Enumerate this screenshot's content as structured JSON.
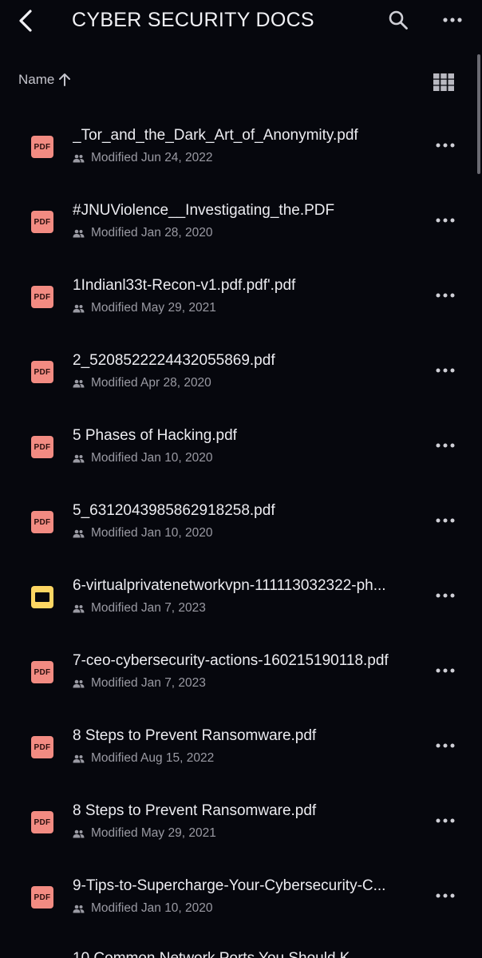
{
  "header": {
    "title": "CYBER SECURITY DOCS",
    "back_icon": "chevron-left-icon",
    "search_icon": "search-icon",
    "more_icon": "more-horizontal-icon"
  },
  "sort": {
    "label": "Name",
    "direction_icon": "arrow-up-icon",
    "view_toggle_icon": "grid-view-icon"
  },
  "colors": {
    "background": "#06070d",
    "pdf_icon": "#f28b82",
    "slides_icon": "#fdd663",
    "text_primary": "#ececf1",
    "text_secondary": "#9a9aa3"
  },
  "files": [
    {
      "name": "_Tor_and_the_Dark_Art_of_Anonymity.pdf",
      "modified": "Modified Jun 24, 2022",
      "type": "pdf",
      "icon_label": "PDF"
    },
    {
      "name": "#JNUViolence__Investigating_the.PDF",
      "modified": "Modified Jan 28, 2020",
      "type": "pdf",
      "icon_label": "PDF"
    },
    {
      "name": "1Indianl33t-Recon-v1.pdf.pdf'.pdf",
      "modified": "Modified May 29, 2021",
      "type": "pdf",
      "icon_label": "PDF"
    },
    {
      "name": "2_5208522224432055869.pdf",
      "modified": "Modified Apr 28, 2020",
      "type": "pdf",
      "icon_label": "PDF"
    },
    {
      "name": "5 Phases of Hacking.pdf",
      "modified": "Modified Jan 10, 2020",
      "type": "pdf",
      "icon_label": "PDF"
    },
    {
      "name": "5_6312043985862918258.pdf",
      "modified": "Modified Jan 10, 2020",
      "type": "pdf",
      "icon_label": "PDF"
    },
    {
      "name": "6-virtualprivatenetworkvpn-111113032322-ph...",
      "modified": "Modified Jan 7, 2023",
      "type": "slides",
      "icon_label": ""
    },
    {
      "name": "7-ceo-cybersecurity-actions-160215190118.pdf",
      "modified": "Modified Jan 7, 2023",
      "type": "pdf",
      "icon_label": "PDF"
    },
    {
      "name": "8 Steps to Prevent Ransomware.pdf",
      "modified": "Modified Aug 15, 2022",
      "type": "pdf",
      "icon_label": "PDF"
    },
    {
      "name": "8 Steps to Prevent Ransomware.pdf",
      "modified": "Modified May 29, 2021",
      "type": "pdf",
      "icon_label": "PDF"
    },
    {
      "name": "9-Tips-to-Supercharge-Your-Cybersecurity-C...",
      "modified": "Modified Jan 10, 2020",
      "type": "pdf",
      "icon_label": "PDF"
    }
  ],
  "partial_next_item": "10 Common Network Ports You Should K..."
}
